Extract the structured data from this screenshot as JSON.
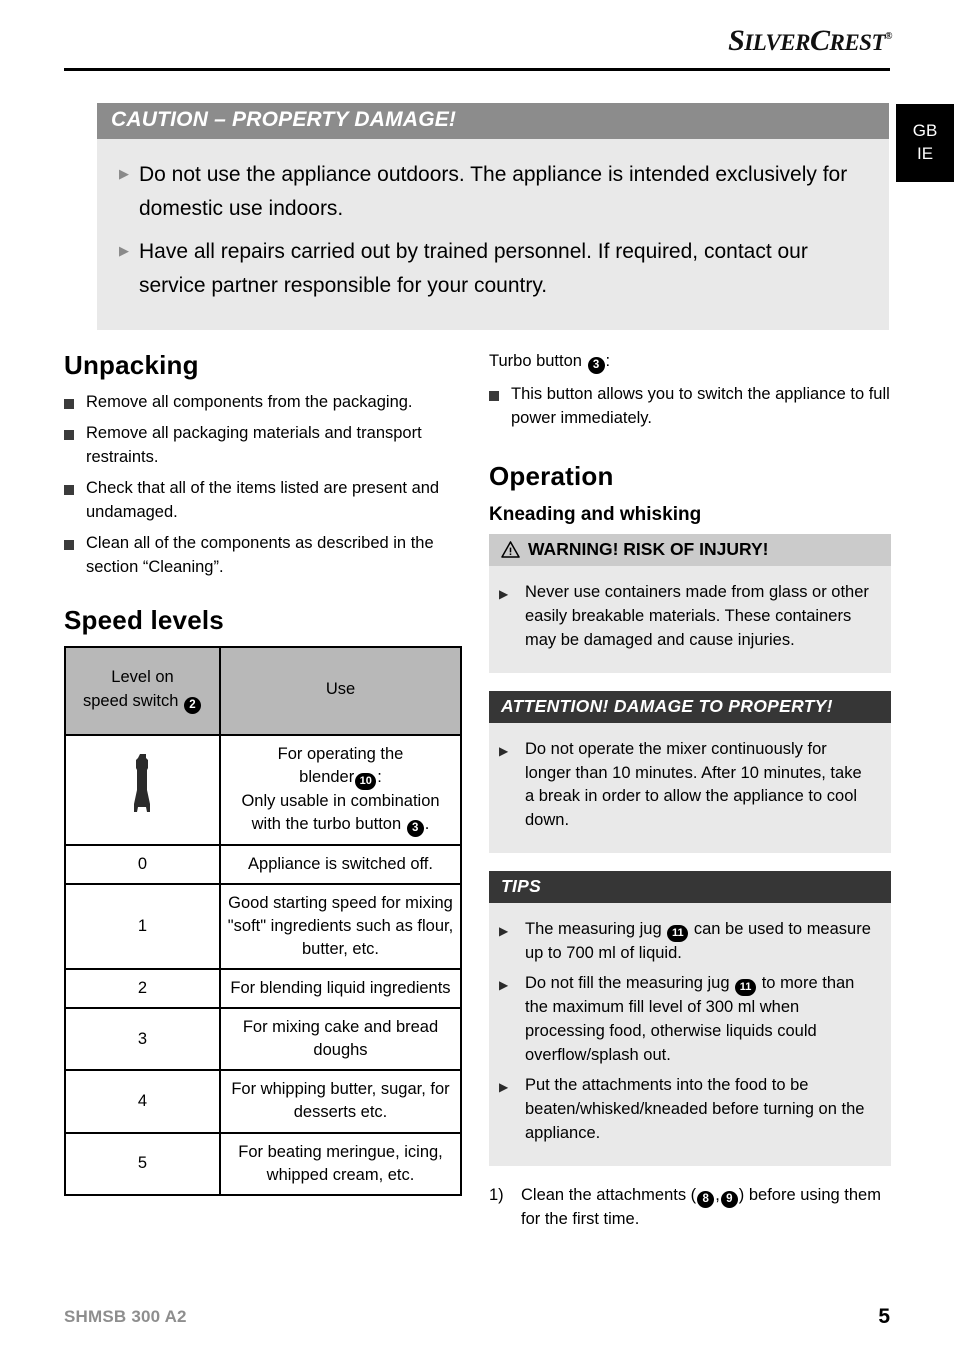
{
  "brand": {
    "name_part1": "S",
    "name_part2": "ILVER",
    "name_part3": "C",
    "name_part4": "REST",
    "registered": "®"
  },
  "language_tab": {
    "line1": "GB",
    "line2": "IE"
  },
  "caution_box": {
    "heading": "CAUTION – PROPERTY DAMAGE!",
    "items": [
      "Do not use the appliance outdoors. The appliance is intended exclusively for domestic use indoors.",
      "Have all repairs carried out by trained personnel. If required, contact our service partner responsible for your country."
    ]
  },
  "left_column": {
    "unpacking": {
      "heading": "Unpacking",
      "items": [
        "Remove all components from the packaging.",
        "Remove all packaging materials and transport restraints.",
        "Check that all of the items listed are present and undamaged.",
        "Clean all of the components as described in the section “Cleaning”."
      ]
    },
    "speed_levels": {
      "heading": "Speed levels",
      "table": {
        "headers": {
          "col1_line1": "Level on",
          "col1_line2": "speed switch",
          "col1_badge": "2",
          "col2": "Use"
        },
        "rows": [
          {
            "level": "",
            "level_icon": "blender-wand-icon",
            "use_lines": [
              "For operating the",
              "blender  :",
              "Only usable in combination",
              "with the turbo button  ."
            ],
            "use_badges": [
              "10",
              "3"
            ]
          },
          {
            "level": "0",
            "use": "Appliance is switched off."
          },
          {
            "level": "1",
            "use": "Good starting speed for mixing \"soft\" ingredients such as flour, butter, etc."
          },
          {
            "level": "2",
            "use": "For blending liquid ingredients"
          },
          {
            "level": "3",
            "use": "For mixing cake and bread doughs"
          },
          {
            "level": "4",
            "use": "For whipping butter, sugar, for desserts etc."
          },
          {
            "level": "5",
            "use": "For beating meringue, icing, whipped cream, etc."
          }
        ]
      }
    }
  },
  "right_column": {
    "turbo": {
      "label": "Turbo button",
      "badge": "3",
      "colon": ":",
      "items": [
        "This button allows you to switch the appliance to full power immediately."
      ]
    },
    "operation": {
      "heading": "Operation",
      "subheading": "Kneading and whisking"
    },
    "warning_box": {
      "icon": "warning-triangle-icon",
      "heading": "WARNING! RISK OF INJURY!",
      "items": [
        "Never use containers made from glass or other easily breakable materials. These containers may be damaged and cause injuries."
      ]
    },
    "attention_box": {
      "heading": "ATTENTION! DAMAGE TO PROPERTY!",
      "items": [
        "Do not operate the mixer continuously for longer than 10 minutes. After 10 minutes, take a break in order to allow the appliance to cool down."
      ]
    },
    "tips_box": {
      "heading": "TIPS",
      "items": [
        {
          "before": "The measuring jug",
          "badge": "11",
          "after": "can be used to measure up to 700 ml of liquid."
        },
        {
          "before": "Do not fill the measuring jug",
          "badge": "11",
          "after": "to more than the maximum fill level of 300 ml when processing food, otherwise liquids could overflow/splash out."
        },
        {
          "before": "",
          "badge": "",
          "after": "Put the attachments into the food to be beaten/whisked/kneaded before turning on the appliance."
        }
      ]
    },
    "steps": [
      {
        "number": "1)",
        "before": "Clean the attachments (",
        "badge_a": "8",
        "sep": ",",
        "badge_b": "9",
        "after": ") before using them for the first time."
      }
    ]
  },
  "footer": {
    "model_code": "SHMSB 300 A2",
    "page_number": "5"
  },
  "colors": {
    "caution_header": "#8c8c8c",
    "box_body": "#e9e9e9",
    "warning_header": "#cbcbcb",
    "dark_header": "#363636",
    "table_header": "#b8b8b8",
    "footer_code": "#8e8e8e"
  }
}
